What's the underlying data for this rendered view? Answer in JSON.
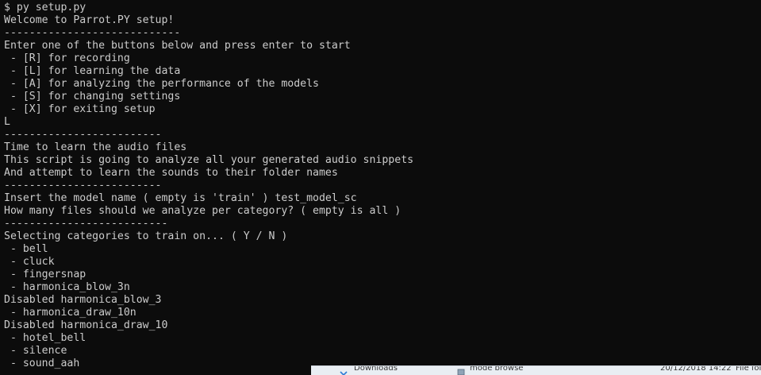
{
  "terminal": {
    "top_fragment": "...",
    "lines": [
      "$ py setup.py",
      "Welcome to Parrot.PY setup!",
      "----------------------------",
      "Enter one of the buttons below and press enter to start",
      " - [R] for recording",
      " - [L] for learning the data",
      " - [A] for analyzing the performance of the models",
      " - [S] for changing settings",
      " - [X] for exiting setup",
      "L",
      "-------------------------",
      "Time to learn the audio files",
      "This script is going to analyze all your generated audio snippets",
      "And attempt to learn the sounds to their folder names",
      "-------------------------",
      "Insert the model name ( empty is 'train' ) test_model_sc",
      "How many files should we analyze per category? ( empty is all )",
      "--------------------------",
      "Selecting categories to train on... ( Y / N )",
      " - bell",
      " - cluck",
      " - fingersnap",
      " - harmonica_blow_3n",
      "Disabled harmonica_blow_3",
      " - harmonica_draw_10n",
      "Disabled harmonica_draw_10",
      " - hotel_bell",
      " - silence",
      " - sound_aah"
    ]
  },
  "taskbar": {
    "items": [
      {
        "label": "Downloads",
        "icon": "folder-icon"
      },
      {
        "label": "mode browse",
        "icon": "window-icon"
      },
      {
        "label": "20/12/2018 14:22",
        "icon": ""
      },
      {
        "label": "File folder",
        "icon": ""
      }
    ]
  },
  "colors": {
    "background": "#0c0c0c",
    "text": "#cccccc"
  }
}
